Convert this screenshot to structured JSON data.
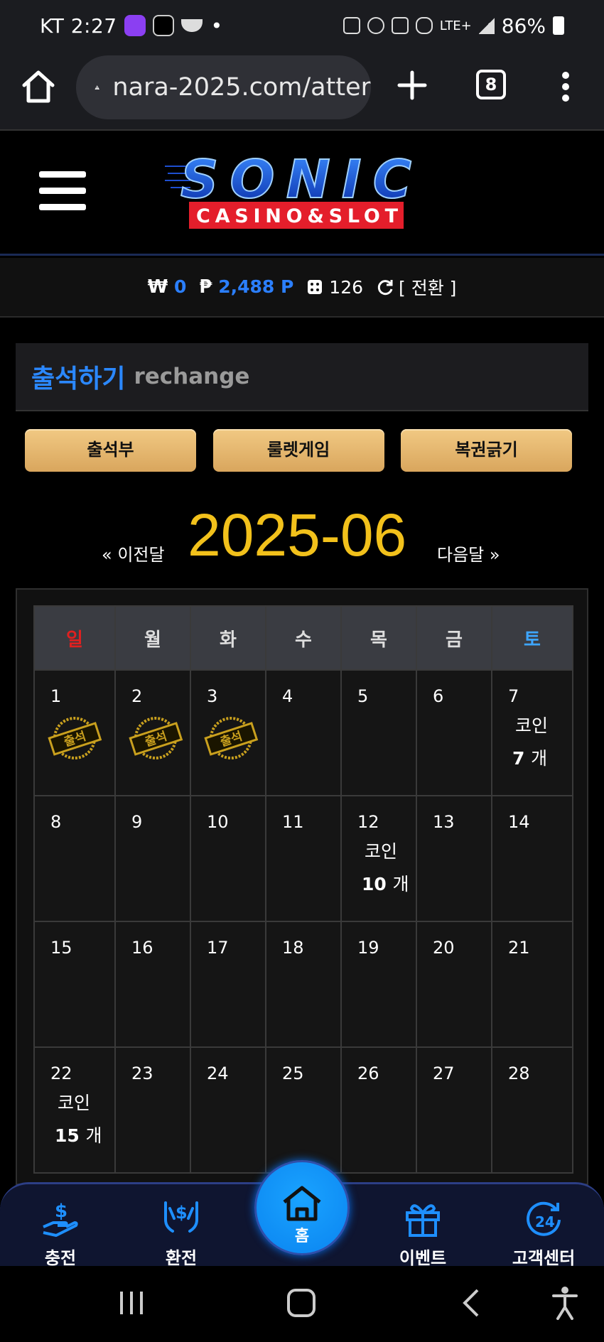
{
  "status": {
    "carrier_time": "KT 2:27",
    "dot": "•",
    "network": "LTE+",
    "battery": "86%"
  },
  "browser": {
    "url": "nara-2025.com/atter",
    "tab_count": "8"
  },
  "wallet": {
    "won_symbol": "₩",
    "won_value": "0",
    "point_symbol": "₱",
    "point_value": "2,488 P",
    "ticket_value": "126",
    "switch_label": "[ 전환 ]"
  },
  "section": {
    "title": "출석하기",
    "subtitle": "rechange"
  },
  "buttons": {
    "attendance": "출석부",
    "roulette": "룰렛게임",
    "lottery": "복권긁기"
  },
  "calendar": {
    "prev_label": "« 이전달",
    "month": "2025-06",
    "next_label": "다음달 »",
    "weekdays": [
      "일",
      "월",
      "화",
      "수",
      "목",
      "금",
      "토"
    ],
    "stamp_text": "출석",
    "coin_label": "코인",
    "coin_unit": "개",
    "weeks": [
      [
        {
          "day": "1",
          "stamp": true
        },
        {
          "day": "2",
          "stamp": true
        },
        {
          "day": "3",
          "stamp": true
        },
        {
          "day": "4"
        },
        {
          "day": "5"
        },
        {
          "day": "6"
        },
        {
          "day": "7",
          "coins": "7"
        }
      ],
      [
        {
          "day": "8"
        },
        {
          "day": "9"
        },
        {
          "day": "10"
        },
        {
          "day": "11"
        },
        {
          "day": "12",
          "coins": "10"
        },
        {
          "day": "13"
        },
        {
          "day": "14"
        }
      ],
      [
        {
          "day": "15"
        },
        {
          "day": "16"
        },
        {
          "day": "17"
        },
        {
          "day": "18"
        },
        {
          "day": "19"
        },
        {
          "day": "20"
        },
        {
          "day": "21"
        }
      ],
      [
        {
          "day": "22",
          "coins": "15"
        },
        {
          "day": "23"
        },
        {
          "day": "24"
        },
        {
          "day": "25"
        },
        {
          "day": "26"
        },
        {
          "day": "27"
        },
        {
          "day": "28"
        }
      ]
    ]
  },
  "bottom_nav": {
    "charge": "충전",
    "exchange": "환전",
    "home": "홈",
    "event": "이벤트",
    "support": "고객센터"
  },
  "colors": {
    "accent_blue": "#2b88ff",
    "gold_button": "#e5b56f",
    "month_yellow": "#f2c11b",
    "sunday_red": "#e02020",
    "saturday_blue": "#3ea6ff"
  },
  "icons": [
    "home-icon",
    "warning-icon",
    "plus-icon",
    "more-icon",
    "menu-icon",
    "refresh-icon",
    "dice-icon",
    "hand-coin-icon",
    "exchange-icon",
    "gift-icon",
    "support-24-icon"
  ]
}
